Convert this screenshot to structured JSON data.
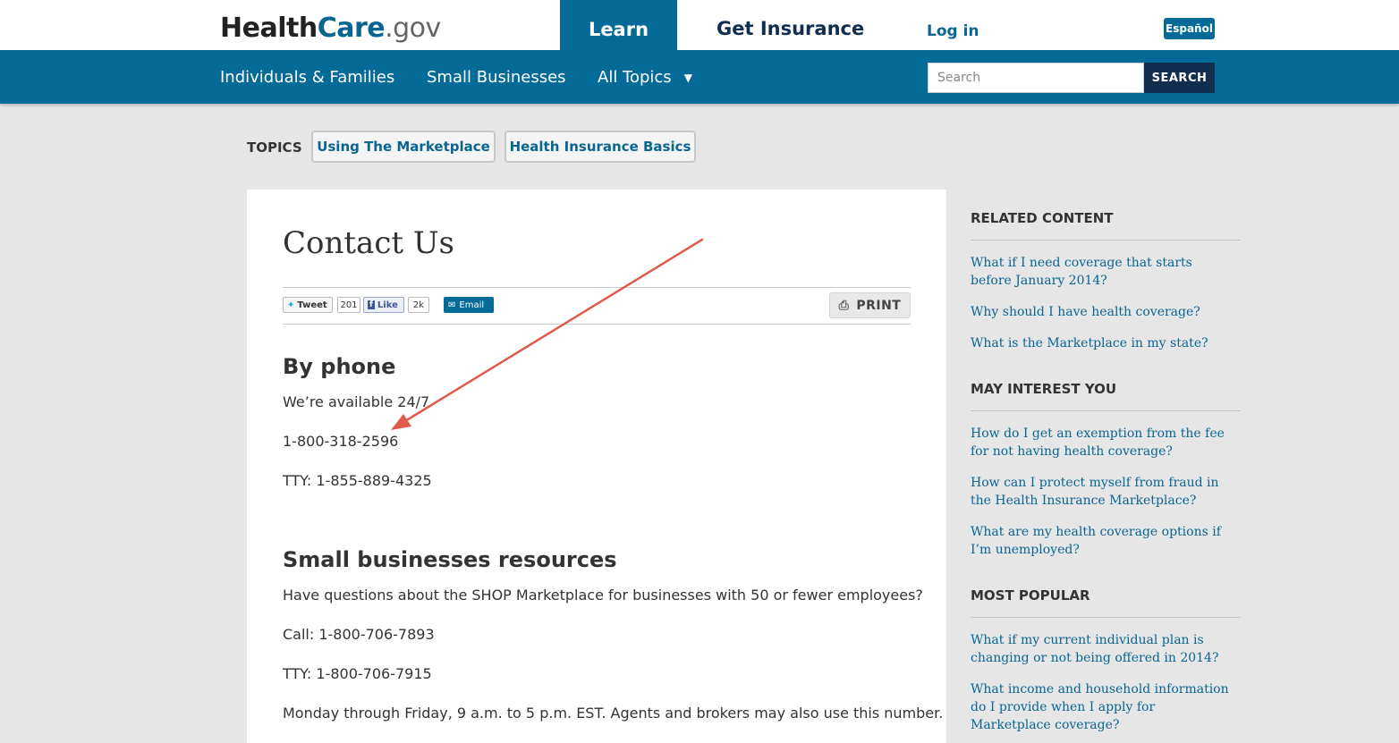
{
  "header": {
    "logo": {
      "part1": "Health",
      "part2": "Care",
      "part3": ".gov"
    },
    "nav": {
      "learn": "Learn",
      "get_insurance": "Get Insurance",
      "login": "Log in"
    },
    "language": "Español"
  },
  "subnav": {
    "individuals": "Individuals & Families",
    "small_businesses": "Small Businesses",
    "all_topics": "All Topics",
    "search_placeholder": "Search",
    "search_button": "SEARCH"
  },
  "topics": {
    "label": "TOPICS",
    "items": [
      "Using The Marketplace",
      "Health Insurance Basics"
    ]
  },
  "main": {
    "title": "Contact Us",
    "social": {
      "tweet": "Tweet",
      "tweet_count": "201",
      "like": "Like",
      "like_count": "2k",
      "email": "Email"
    },
    "print": "PRINT",
    "phone": {
      "heading": "By phone",
      "available": "We’re available 24/7",
      "number": "1-800-318-2596",
      "tty": "TTY: 1-855-889-4325"
    },
    "small_business": {
      "heading": "Small businesses resources",
      "question": "Have questions about the SHOP Marketplace for businesses with 50 or fewer employees?",
      "call": "Call: 1-800-706-7893",
      "tty": "TTY: 1-800-706-7915",
      "hours": "Monday through Friday, 9 a.m. to 5 p.m. EST. Agents and brokers may also use this number."
    }
  },
  "sidebar": {
    "related": {
      "heading": "RELATED CONTENT",
      "links": [
        "What if I need coverage that starts before January 2014?",
        "Why should I have health coverage?",
        "What is the Marketplace in my state?"
      ]
    },
    "interest": {
      "heading": "MAY INTEREST YOU",
      "links": [
        "How do I get an exemption from the fee for not having health coverage?",
        "How can I protect myself from fraud in the Health Insurance Marketplace?",
        "What are my health coverage options if I’m unemployed?"
      ]
    },
    "popular": {
      "heading": "MOST POPULAR",
      "links": [
        "What if my current individual plan is changing or not being offered in 2014?",
        "What income and household information do I provide when I apply for Marketplace coverage?"
      ]
    }
  },
  "colors": {
    "brand_blue": "#046b99",
    "dark_navy": "#112e51",
    "link_blue": "#0a6591",
    "annotation_arrow": "#e05a4a"
  }
}
